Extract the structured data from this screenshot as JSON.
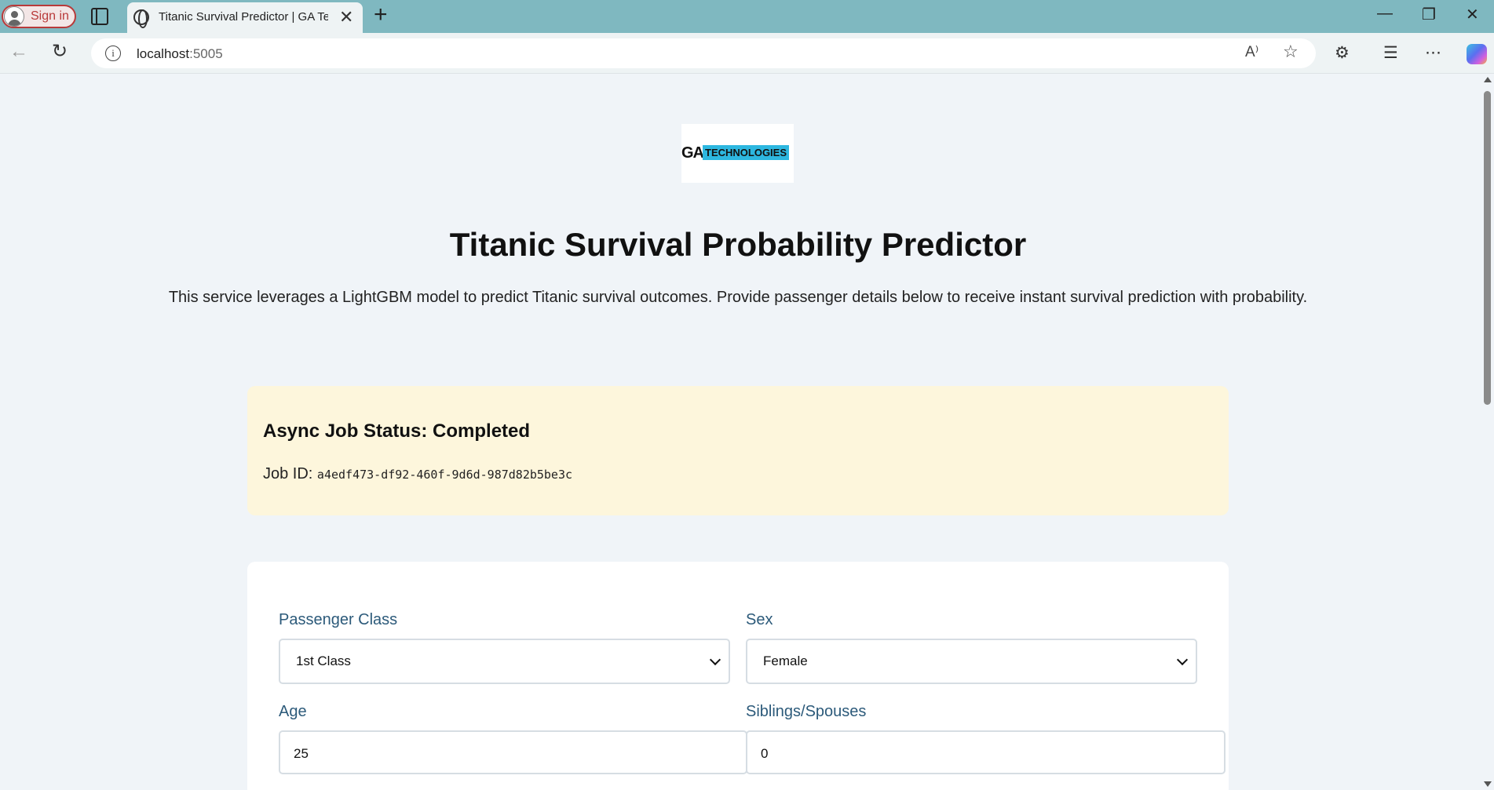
{
  "browser": {
    "signin_label": "Sign in",
    "tab_title": "Titanic Survival Predictor | GA Technologies",
    "tab_close": "✕",
    "new_tab": "+",
    "url_host": "localhost",
    "url_port": ":5005",
    "window_controls": {
      "minimize": "—",
      "restore": "❐",
      "close": "✕"
    },
    "toolbar_icons": [
      "read-aloud-icon",
      "favorite-star-icon",
      "extensions-icon",
      "favorites-icon",
      "more-icon",
      "copilot-icon"
    ]
  },
  "header": {
    "logo_left": "GA",
    "logo_right": "TECHNOLOGIES",
    "title": "Titanic Survival Probability Predictor",
    "subtitle": "This service leverages a LightGBM model to predict Titanic survival outcomes. Provide passenger details below to receive instant survival prediction with probability."
  },
  "status": {
    "heading": "Async Job Status: Completed",
    "job_label": "Job ID:",
    "job_id": "a4edf473-df92-460f-9d6d-987d82b5be3c",
    "background_color": "#fdf6dc"
  },
  "form": {
    "pclass": {
      "label": "Passenger Class",
      "value": "1st Class"
    },
    "sex": {
      "label": "Sex",
      "value": "Female"
    },
    "age": {
      "label": "Age",
      "value": "25"
    },
    "sibsp": {
      "label": "Siblings/Spouses",
      "value": "0"
    },
    "label_color": "#2c5a7a"
  }
}
